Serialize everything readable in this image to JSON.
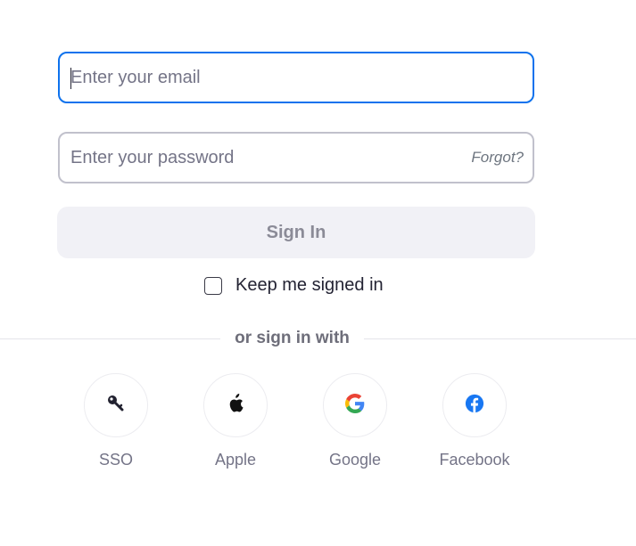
{
  "email": {
    "placeholder": "Enter your email",
    "value": ""
  },
  "password": {
    "placeholder": "Enter your password",
    "value": "",
    "forgot_label": "Forgot?"
  },
  "sign_in_label": "Sign In",
  "keep_signed_in": {
    "label": "Keep me signed in",
    "checked": false
  },
  "divider_label": "or sign in with",
  "providers": [
    {
      "label": "SSO",
      "icon": "key-icon"
    },
    {
      "label": "Apple",
      "icon": "apple-icon"
    },
    {
      "label": "Google",
      "icon": "google-icon"
    },
    {
      "label": "Facebook",
      "icon": "facebook-icon"
    }
  ],
  "colors": {
    "focus_border": "#0e72ed",
    "field_border": "#c1c1cc",
    "signin_bg": "#f1f1f6",
    "signin_text": "#8b8b97",
    "facebook_blue": "#1877f2"
  }
}
